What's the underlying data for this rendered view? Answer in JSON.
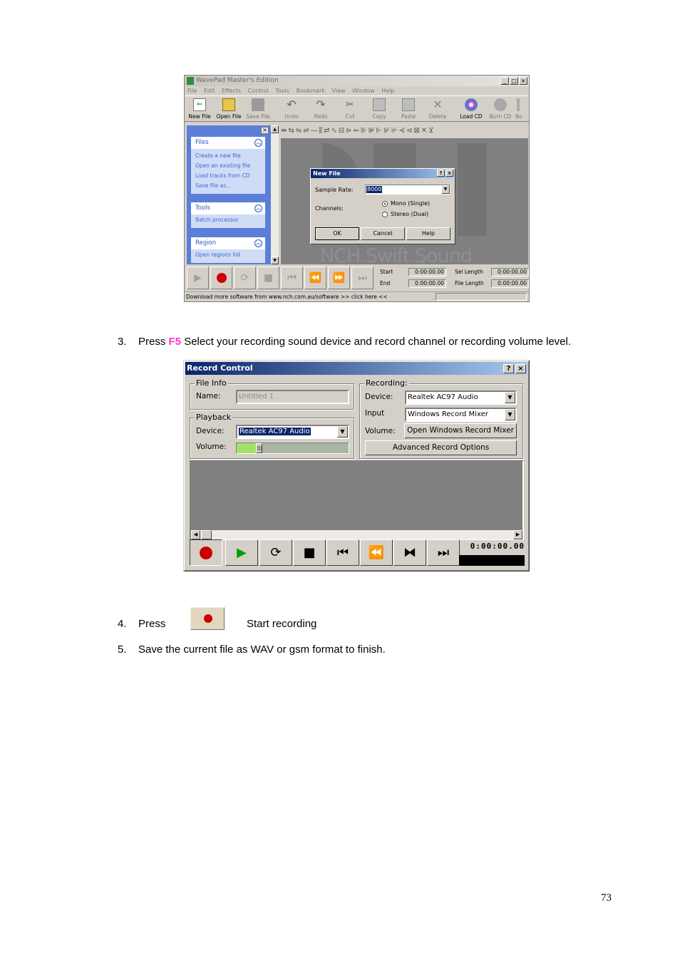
{
  "wavepad": {
    "title": "WavePad Master's Edition",
    "menu": [
      "File",
      "Edit",
      "Effects",
      "Control",
      "Tools",
      "Bookmark",
      "View",
      "Window",
      "Help"
    ],
    "toolbar": [
      "New File",
      "Open File",
      "Save File",
      "Undo",
      "Redo",
      "Cut",
      "Copy",
      "Paste",
      "Delete",
      "Load CD",
      "Burn CD",
      "Bo"
    ],
    "sidebar": {
      "files_title": "Files",
      "files_links": [
        "Create a new file",
        "Open an existing file",
        "Load tracks from CD",
        "Save file as..."
      ],
      "tools_title": "Tools",
      "tools_links": [
        "Batch processor"
      ],
      "region_title": "Region",
      "region_links": [
        "Open regions list"
      ]
    },
    "watermark": "NCH Swift Sound",
    "dialog": {
      "title": "New File",
      "sample_rate_label": "Sample Rate:",
      "sample_rate_value": "8000",
      "channels_label": "Channels:",
      "mono": "Mono (Single)",
      "stereo": "Stereo (Dual)",
      "ok": "OK",
      "cancel": "Cancel",
      "help": "Help"
    },
    "time": {
      "start_label": "Start",
      "start_value": "0:00:00.00",
      "end_label": "End",
      "end_value": "0:00:00.00",
      "sel_length_label": "Sel Length",
      "sel_length_value": "0:00:00.00",
      "file_length_label": "File Length",
      "file_length_value": "0:00:00.00"
    },
    "status": "Download more software from www.nch.com.au/software >> click here <<"
  },
  "steps": {
    "s3_num": "3.",
    "s3_pre": "Press ",
    "s3_key": "F5",
    "s3_rest": " Select your recording sound device and record channel or recording volume level.",
    "s4_num": "4.",
    "s4_pre": "Press",
    "s4_post": "Start recording",
    "s5_num": "5.",
    "s5_text": "Save the current file as WAV or gsm format to finish."
  },
  "record_control": {
    "title": "Record Control",
    "file_info": "File Info",
    "name_label": "Name:",
    "name_value": "Untitled 1",
    "playback": "Playback",
    "pb_device_label": "Device:",
    "pb_device_value": "Realtek AC97 Audio",
    "volume_label": "Volume:",
    "volume_level": 0.17,
    "recording": "Recording:",
    "rec_device_label": "Device:",
    "rec_device_value": "Realtek AC97 Audio",
    "input_label": "Input",
    "input_value": "Windows Record Mixer",
    "rec_volume_label": "Volume:",
    "open_mixer": "Open Windows Record Mixer",
    "advanced": "Advanced Record Options",
    "timer": "0:00:00.00"
  },
  "page_number": "73",
  "colors": {
    "accent_key": "#ff33cc",
    "title_blue": "#0a246a",
    "record_red": "#cc0000",
    "play_green": "#00a000"
  }
}
